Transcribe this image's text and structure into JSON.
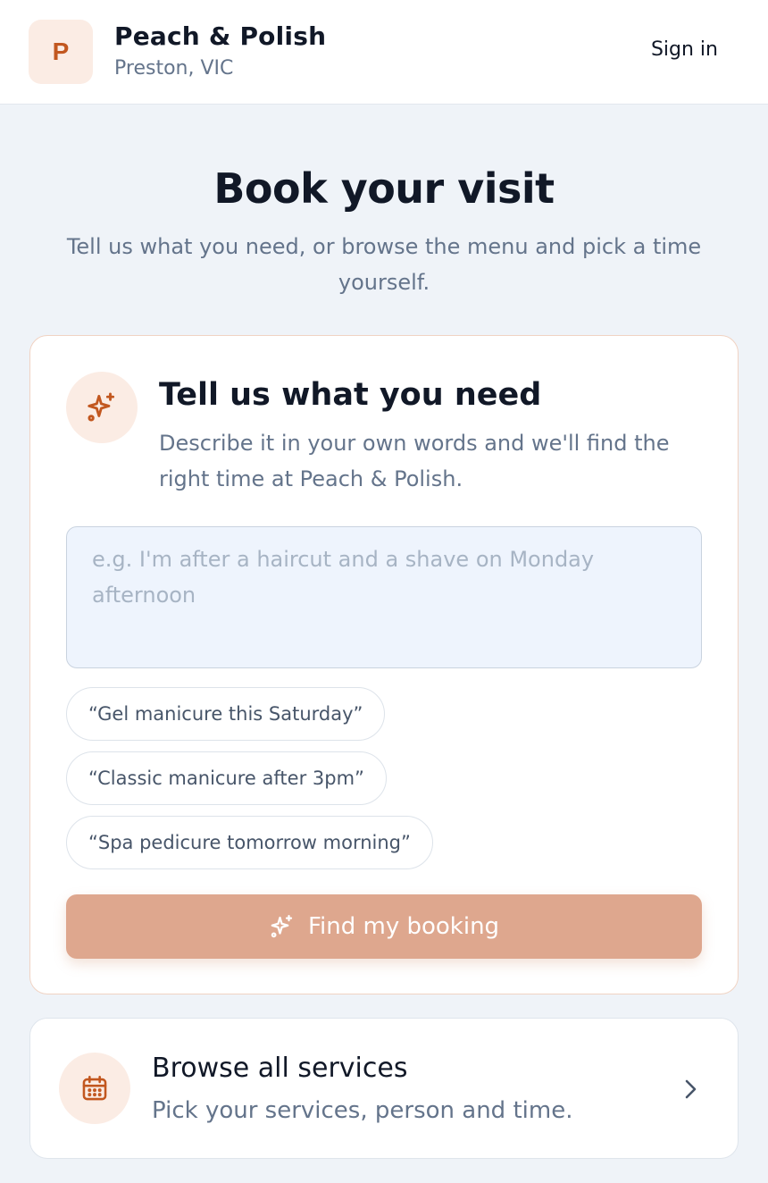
{
  "header": {
    "logo_letter": "P",
    "business_name": "Peach & Polish",
    "location": "Preston, VIC",
    "sign_in_label": "Sign in"
  },
  "hero": {
    "title": "Book your visit",
    "subtitle": "Tell us what you need, or browse the menu and pick a time yourself."
  },
  "ai_card": {
    "icon": "sparkles-icon",
    "title": "Tell us what you need",
    "description": "Describe it in your own words and we'll find the right time at Peach & Polish.",
    "input": {
      "value": "",
      "placeholder": "e.g. I'm after a haircut and a shave on Monday afternoon"
    },
    "suggestions": [
      "“Gel manicure this Saturday”",
      "“Classic manicure after 3pm”",
      "“Spa pedicure tomorrow morning”"
    ],
    "submit_label": "Find my booking",
    "submit_icon": "sparkles-icon"
  },
  "browse_card": {
    "icon": "calendar-icon",
    "title": "Browse all services",
    "description": "Pick your services, person and time.",
    "chevron_icon": "chevron-right-icon"
  },
  "colors": {
    "accent": "#c2571f",
    "accent_soft": "#fbece4",
    "button": "#dea78e",
    "background": "#eff3f8",
    "muted_text": "#64748b"
  }
}
